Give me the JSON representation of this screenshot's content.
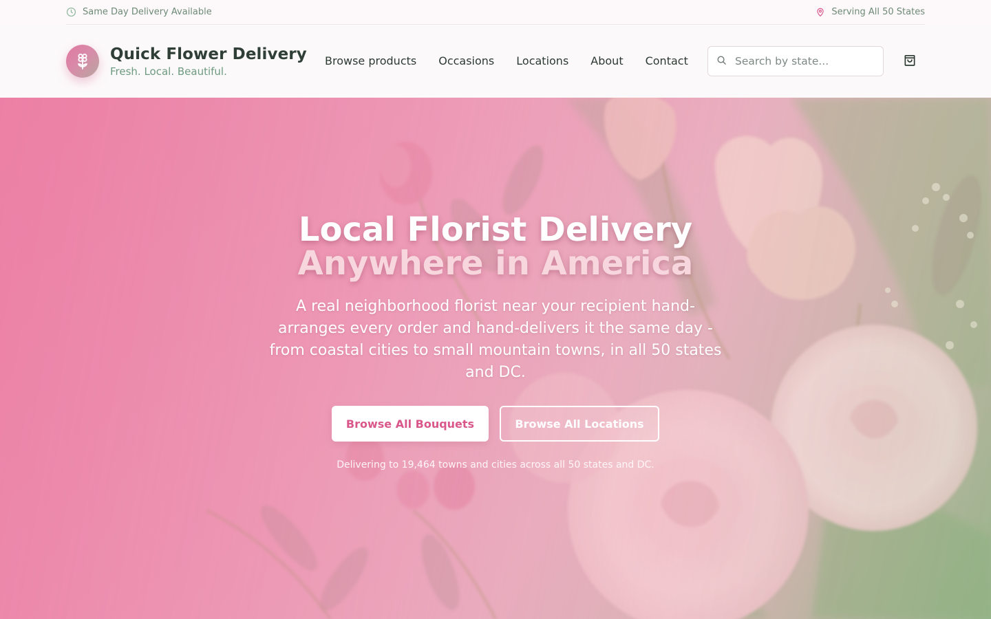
{
  "topbar": {
    "left_text": "Same Day Delivery Available",
    "left_icon": "clock-icon",
    "right_text": "Serving All 50 States",
    "right_icon": "map-pin-icon"
  },
  "brand": {
    "name": "Quick Flower Delivery",
    "tagline": "Fresh. Local. Beautiful.",
    "logo_icon": "flower-icon"
  },
  "nav": {
    "items": [
      {
        "label": "Browse products"
      },
      {
        "label": "Occasions"
      },
      {
        "label": "Locations"
      },
      {
        "label": "About"
      },
      {
        "label": "Contact"
      }
    ]
  },
  "search": {
    "placeholder": "Search by state...",
    "value": "",
    "icon": "search-icon"
  },
  "cart": {
    "icon": "shopping-bag-icon"
  },
  "hero": {
    "title_line1": "Local Florist Delivery",
    "title_line2": "Anywhere in America",
    "subtitle": "A real neighborhood florist near your recipient hand-arranges every order and hand-delivers it the same day - from coastal cities to small mountain towns, in all 50 states and DC.",
    "primary_button": "Browse All Bouquets",
    "secondary_button": "Browse All Locations",
    "note": "Delivering to 19,464 towns and cities across all 50 states and DC."
  },
  "colors": {
    "accent_pink": "#d9578a",
    "brand_green": "#6d9a80",
    "text_dark": "#2f3f37"
  }
}
